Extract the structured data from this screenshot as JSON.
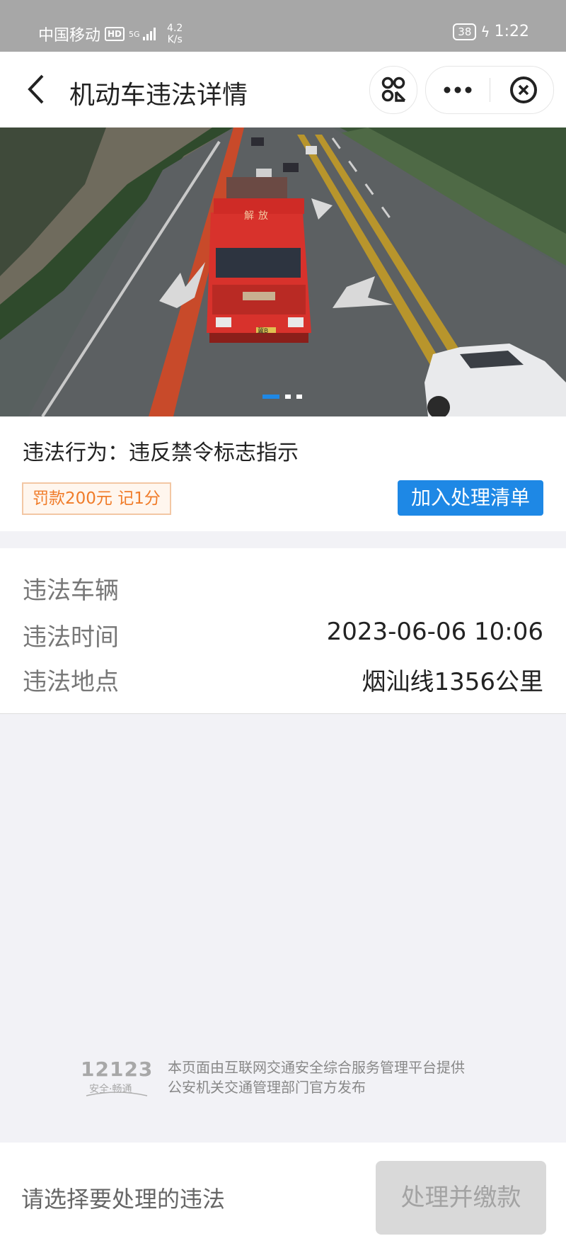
{
  "status_bar": {
    "carrier": "中国移动",
    "hd": "HD",
    "network": "5G",
    "speed_value": "4.2",
    "speed_unit": "K/s",
    "battery": "38",
    "time": "1:22"
  },
  "header": {
    "title": "机动车违法详情"
  },
  "photo": {
    "plate": "冀B",
    "cab_text": "解放",
    "slide_count": 3,
    "active_slide": 1
  },
  "violation": {
    "behavior": "违法行为：违反禁令标志指示",
    "penalty": "罚款200元  记1分",
    "add_button": "加入处理清单"
  },
  "details": {
    "vehicle_label": "违法车辆",
    "vehicle_value": "",
    "time_label": "违法时间",
    "time_value": "2023-06-06 10:06",
    "location_label": "违法地点",
    "location_value": "烟汕线1356公里"
  },
  "footer": {
    "logo_number": "12123",
    "logo_slogan": "安全·畅通",
    "line1": "本页面由互联网交通安全综合服务管理平台提供",
    "line2": "公安机关交通管理部门官方发布"
  },
  "bottom": {
    "hint": "请选择要处理的违法",
    "pay_button": "处理并缴款"
  },
  "colors": {
    "primary": "#1e88e5",
    "penalty_text": "#f07c2a",
    "penalty_border": "#f3c7a4",
    "page_bg": "#f2f2f6",
    "status_bar": "#a7a7a7"
  }
}
